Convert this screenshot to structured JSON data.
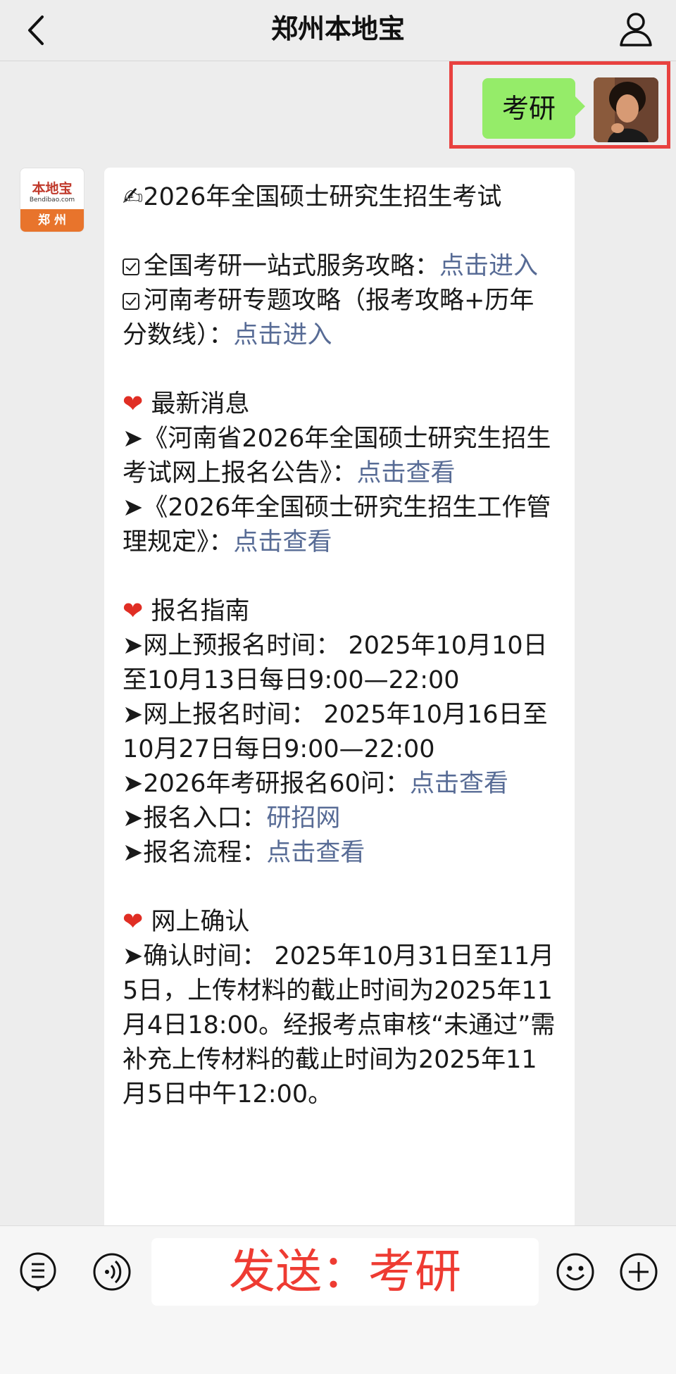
{
  "topbar": {
    "title": "郑州本地宝"
  },
  "sent_message": {
    "text": "考研"
  },
  "bot": {
    "avatar_brand": "本地宝",
    "avatar_domain": "Bendibao.com",
    "avatar_city": "郑 州"
  },
  "message": {
    "headline_icon": "✍",
    "headline": "2026年全国硕士研究生招生考试",
    "guide1_text": "全国考研一站式服务攻略：",
    "guide1_link": "点击进入",
    "guide2_text": "河南考研专题攻略（报考攻略+历年分数线）：",
    "guide2_link": "点击进入",
    "section1_icon": "❤",
    "section1_title": "最新消息",
    "news1_text": "➤《河南省2026年全国硕士研究生招生考试网上报名公告》：",
    "news1_link": "点击查看",
    "news2_text": "➤《2026年全国硕士研究生招生工作管理规定》：",
    "news2_link": "点击查看",
    "section2_icon": "❤",
    "section2_title": "报名指南",
    "reg1": "➤网上预报名时间： 2025年10月10日至10月13日每日9:00—22:00",
    "reg2": "➤网上报名时间： 2025年10月16日至10月27日每日9:00—22:00",
    "reg3_text": "➤2026年考研报名60问：",
    "reg3_link": "点击查看",
    "reg4_text": "➤报名入口：",
    "reg4_link": "研招网",
    "reg5_text": "➤报名流程：",
    "reg5_link": "点击查看",
    "section3_icon": "❤",
    "section3_title": "网上确认",
    "confirm": "➤确认时间： 2025年10月31日至11月5日，上传材料的截止时间为2025年11月4日18:00。经报考点审核“未通过”需补充上传材料的截止时间为2025年11月5日中午12:00。"
  },
  "input_bar": {
    "input_text": "发送：考研"
  },
  "colors": {
    "link": "#576b95",
    "sent_bubble": "#95ec69",
    "highlight_border": "#e8413f",
    "input_text": "#ee3b32"
  },
  "icons": [
    "back-arrow-icon",
    "user-profile-icon",
    "menu-list-icon",
    "voice-icon",
    "emoji-icon",
    "plus-icon"
  ]
}
